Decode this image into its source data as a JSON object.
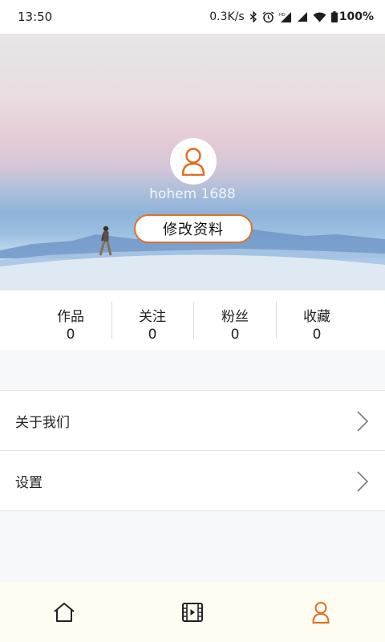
{
  "status_bar": {
    "time": "13:50",
    "network_speed": "0.3K/s",
    "battery_percent": "100%",
    "icons": [
      "bluetooth-icon",
      "alarm-icon",
      "signal-hd-icon",
      "signal-icon",
      "wifi-icon",
      "battery-icon"
    ]
  },
  "profile": {
    "username": "hohem 1688",
    "edit_label": "修改资料",
    "avatar_icon": "user-icon"
  },
  "stats": [
    {
      "label": "作品",
      "value": "0"
    },
    {
      "label": "关注",
      "value": "0"
    },
    {
      "label": "粉丝",
      "value": "0"
    },
    {
      "label": "收藏",
      "value": "0"
    }
  ],
  "menu": [
    {
      "label": "关于我们",
      "icon": "chevron-right-icon"
    },
    {
      "label": "设置",
      "icon": "chevron-right-icon"
    }
  ],
  "bottom_nav": [
    {
      "name": "home",
      "icon": "home-icon",
      "active": false
    },
    {
      "name": "video",
      "icon": "film-icon",
      "active": false
    },
    {
      "name": "profile",
      "icon": "user-icon",
      "active": true
    }
  ],
  "colors": {
    "accent": "#e66a1e",
    "nav_background": "#fffdf1",
    "page_background": "#f7f8fa"
  }
}
